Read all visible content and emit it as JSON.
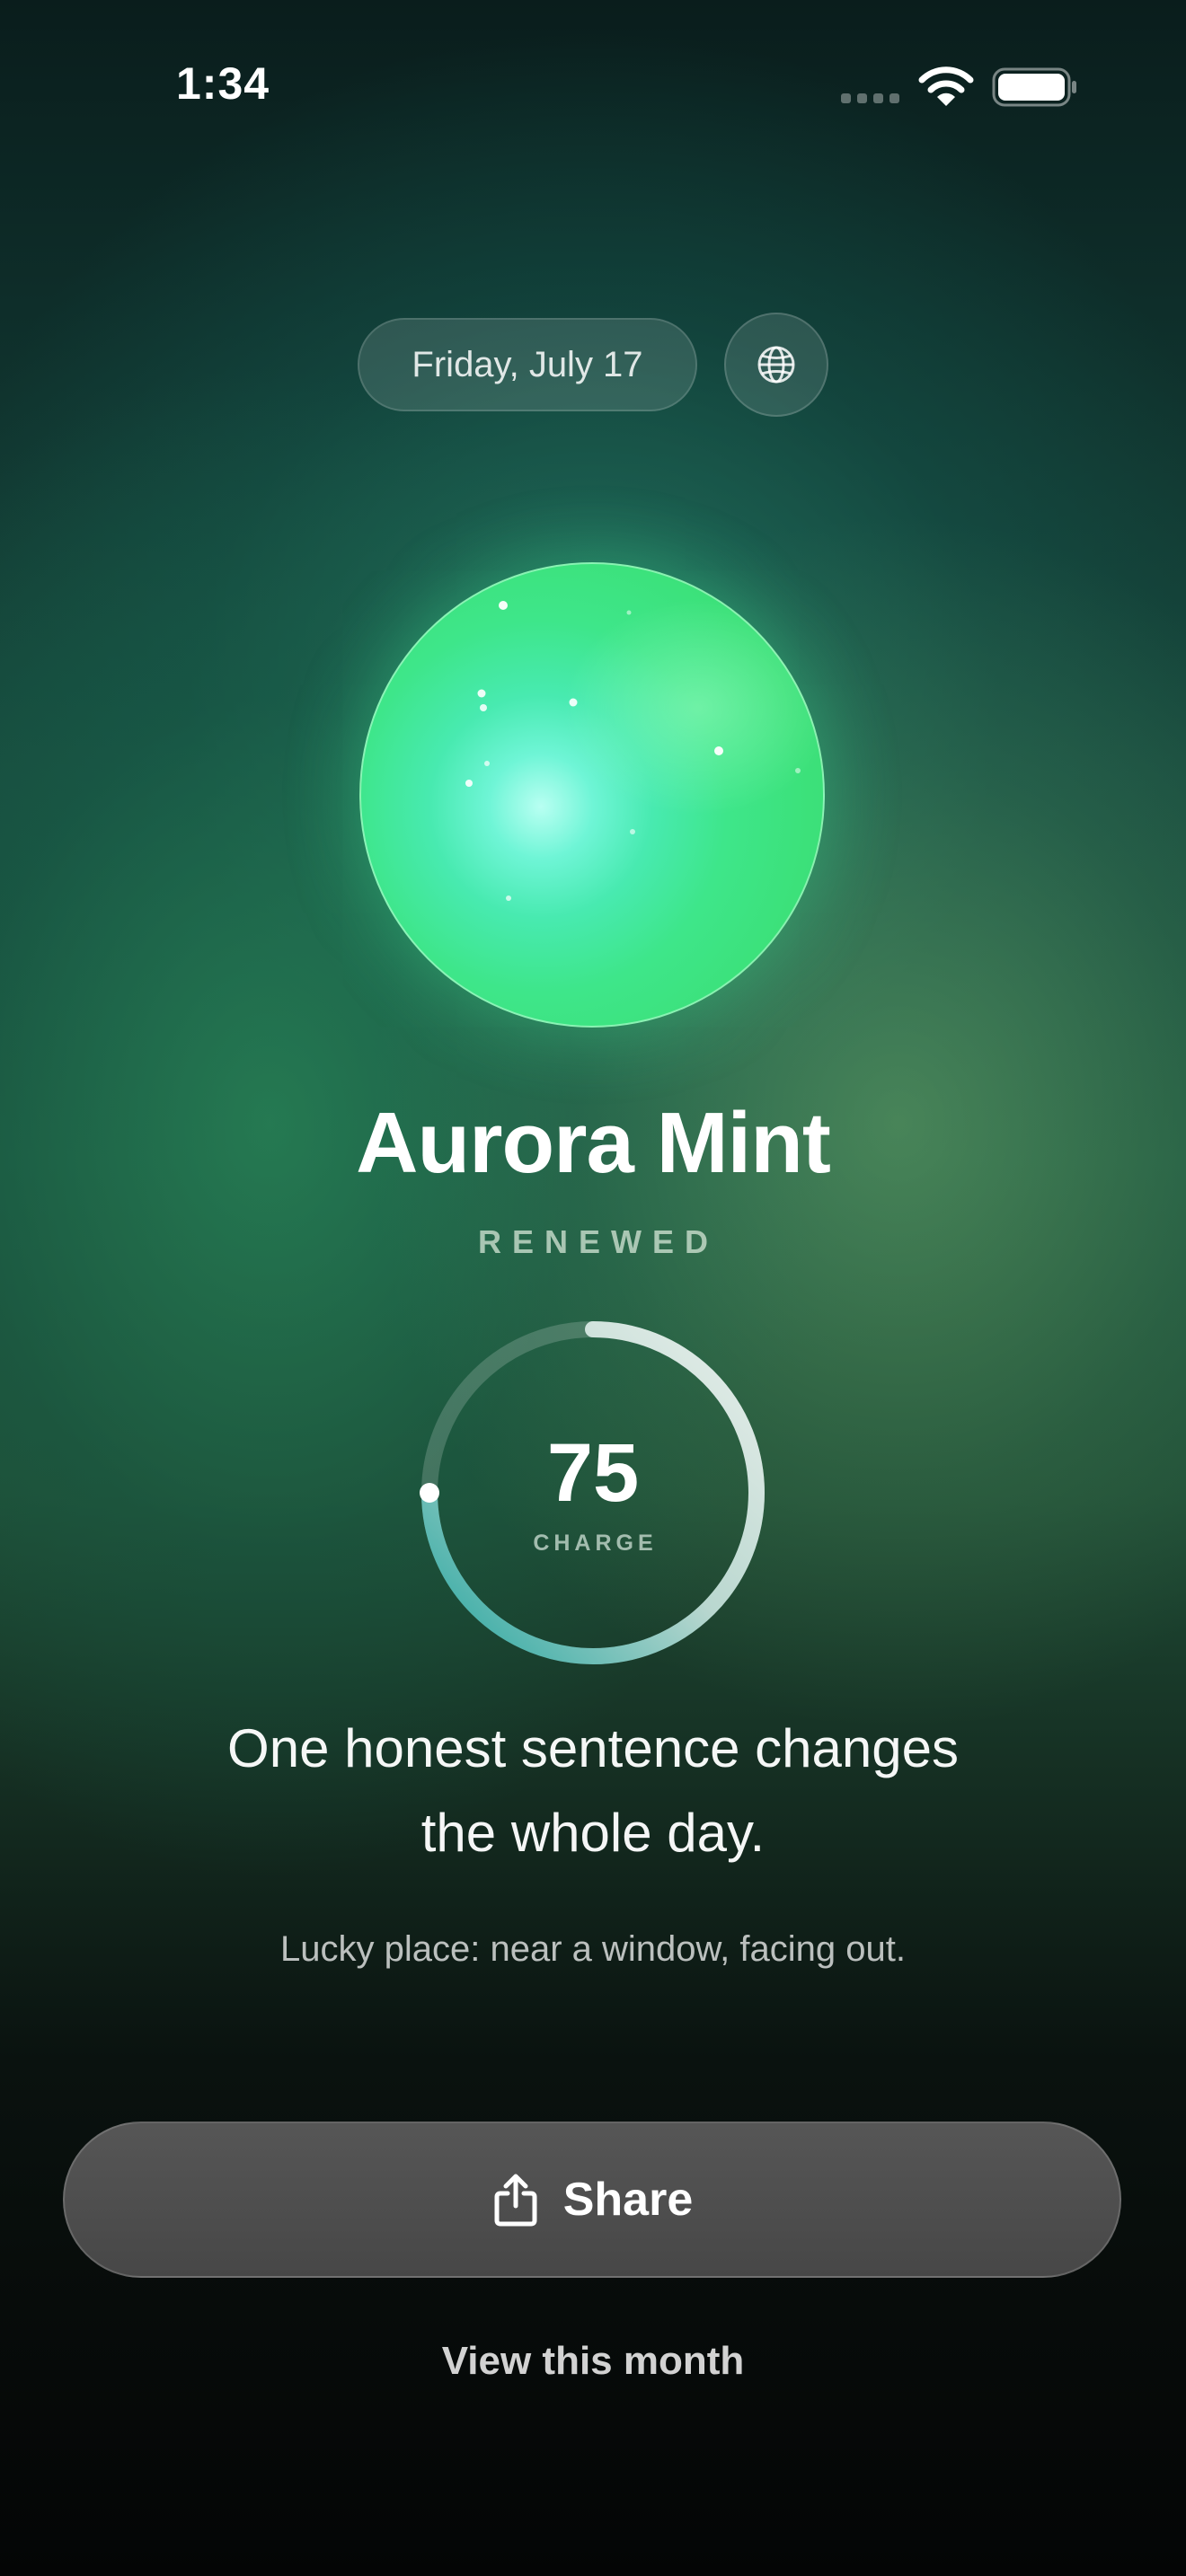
{
  "status_bar": {
    "time": "1:34"
  },
  "header": {
    "date": "Friday, July 17",
    "globe_icon": "globe-icon"
  },
  "aura": {
    "name": "Aurora Mint",
    "status": "RENEWED",
    "orb_colors": [
      "#b8fff2",
      "#48eab0",
      "#3ce17a"
    ]
  },
  "charge": {
    "value": "75",
    "label": "CHARGE",
    "fraction": 0.75
  },
  "message": {
    "line1": "One honest sentence changes",
    "line2": "the whole day.",
    "lucky_place": "Lucky place: near a window, facing out."
  },
  "actions": {
    "share_label": "Share",
    "share_icon": "share-icon",
    "month_link": "View this month"
  },
  "colors": {
    "accent": "#3ce17a",
    "button_bg": "#4f4f4f"
  }
}
